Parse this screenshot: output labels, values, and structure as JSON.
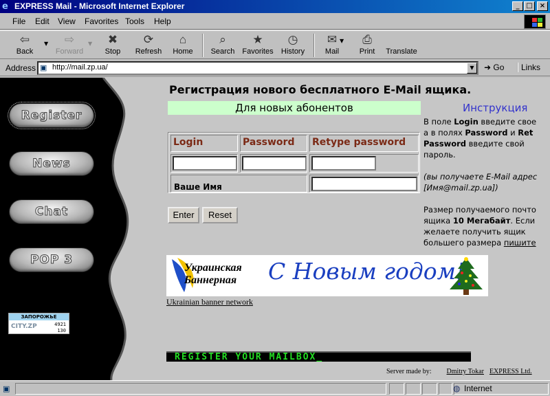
{
  "window": {
    "title": "EXPRESS Mail - Microsoft Internet Explorer",
    "buttons": {
      "minimize": "_",
      "maximize": "□",
      "close": "×"
    }
  },
  "menu": [
    "File",
    "Edit",
    "View",
    "Favorites",
    "Tools",
    "Help"
  ],
  "toolbar": [
    {
      "label": "Back",
      "icon": "back-arrow-icon",
      "glyph": "⇦",
      "enabled": true
    },
    {
      "label": "Forward",
      "icon": "forward-arrow-icon",
      "glyph": "⇨",
      "enabled": false
    },
    {
      "label": "Stop",
      "icon": "stop-icon",
      "glyph": "✖",
      "enabled": true
    },
    {
      "label": "Refresh",
      "icon": "refresh-icon",
      "glyph": "⟳",
      "enabled": true
    },
    {
      "label": "Home",
      "icon": "home-icon",
      "glyph": "⌂",
      "enabled": true
    },
    {
      "label": "Search",
      "icon": "search-icon",
      "glyph": "⌕",
      "enabled": true
    },
    {
      "label": "Favorites",
      "icon": "favorites-icon",
      "glyph": "★",
      "enabled": true
    },
    {
      "label": "History",
      "icon": "history-icon",
      "glyph": "◷",
      "enabled": true
    },
    {
      "label": "Mail",
      "icon": "mail-icon",
      "glyph": "✉",
      "enabled": true
    },
    {
      "label": "Print",
      "icon": "print-icon",
      "glyph": "⎙",
      "enabled": true
    },
    {
      "label": "Translate",
      "icon": "translate-icon",
      "glyph": "",
      "enabled": true
    }
  ],
  "address": {
    "label": "Address",
    "url": "http://mail.zp.ua/",
    "go": "Go",
    "links": "Links"
  },
  "nav": [
    "Register",
    "News",
    "Chat",
    "POP 3"
  ],
  "city_counter": {
    "header": "ЗАПОРОЖЬЕ",
    "name": "CITY.ZP",
    "count1": "4921",
    "count2": "130"
  },
  "page": {
    "heading": "Регистрация нового бесплатного E-Mail ящика.",
    "subheading": "Для новых абонентов",
    "instructions_link": "Инструкция",
    "instructions": [
      {
        "parts": [
          {
            "t": "В поле ",
            "b": false
          },
          {
            "t": "Login",
            "b": true
          },
          {
            "t": " введите свое",
            "b": false
          }
        ]
      },
      {
        "parts": [
          {
            "t": "а в полях ",
            "b": false
          },
          {
            "t": "Password",
            "b": true
          },
          {
            "t": " и ",
            "b": false
          },
          {
            "t": "Ret",
            "b": true
          }
        ]
      },
      {
        "parts": [
          {
            "t": "Password",
            "b": true
          },
          {
            "t": " введите свой",
            "b": false
          }
        ]
      },
      {
        "parts": [
          {
            "t": "пароль.",
            "b": false
          }
        ]
      }
    ],
    "note_line1": "(вы получаете E-Mail адрес",
    "note_line2": "[Имя@mail.zp.ua])",
    "size_line1": "Размер получаемого почто",
    "size_line2_a": "ящика ",
    "size_line2_b": "10 Мегабайт",
    "size_line2_c": ". Если",
    "size_line3": "желаете получить ящик",
    "size_line4_a": "большего размера ",
    "size_line4_link": "пишите"
  },
  "form": {
    "login_header": "Login",
    "password_header": "Password",
    "retype_header": "Retype password",
    "name_label": "Ваше Имя",
    "login_value": "",
    "password_value": "",
    "retype_value": "",
    "name_value": "",
    "enter_button": "Enter",
    "reset_button": "Reset"
  },
  "banner": {
    "company_line1": "Украинская",
    "company_line2": "Баннерная",
    "greeting": "С Новым годом!",
    "link": "Ukrainian banner network"
  },
  "marquee": "REGISTER YOUR MAILBOX_",
  "credits": {
    "made_by": "Server made by:",
    "author": "Dmitry Tokar",
    "company": "EXPRESS Ltd."
  },
  "status": {
    "zone": "Internet"
  }
}
